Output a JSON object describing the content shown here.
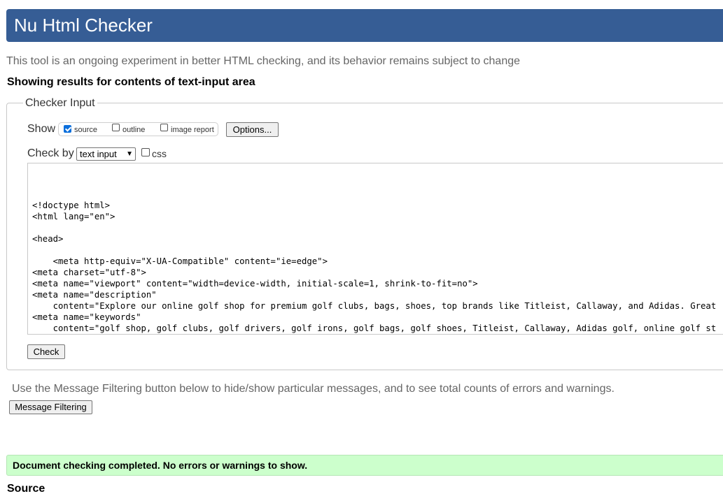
{
  "header": {
    "title": "Nu Html Checker"
  },
  "intro_text": "This tool is an ongoing experiment in better HTML checking, and its behavior remains subject to change",
  "results_heading": "Showing results for contents of text-input area",
  "checker_input": {
    "legend": "Checker Input",
    "show_label": "Show",
    "show_options": [
      {
        "label": "source",
        "checked": true
      },
      {
        "label": "outline",
        "checked": false
      },
      {
        "label": "image report",
        "checked": false
      }
    ],
    "options_button": "Options...",
    "check_by_label": "Check by",
    "check_by_value": "text input",
    "css_label": "css",
    "css_checked": false,
    "textarea_value": "\n\n\n<!doctype html>\n<html lang=\"en\">\n\n<head>\n\n    <meta http-equiv=\"X-UA-Compatible\" content=\"ie=edge\">\n<meta charset=\"utf-8\">\n<meta name=\"viewport\" content=\"width=device-width, initial-scale=1, shrink-to-fit=no\">\n<meta name=\"description\"\n    content=\"Explore our online golf shop for premium golf clubs, bags, shoes, top brands like Titleist, Callaway, and Adidas. Great\n<meta name=\"keywords\"\n    content=\"golf shop, golf clubs, golf drivers, golf irons, golf bags, golf shoes, Titleist, Callaway, Adidas golf, online golf st",
    "check_button": "Check"
  },
  "filter_note": "Use the Message Filtering button below to hide/show particular messages, and to see total counts of errors and warnings.",
  "message_filtering_button": "Message Filtering",
  "success_message": "Document checking completed. No errors or warnings to show.",
  "source_heading": "Source",
  "colors": {
    "header_bg": "#365d95",
    "success_bg": "#ccffcc",
    "checkbox_checked": "#0b6fdc"
  }
}
